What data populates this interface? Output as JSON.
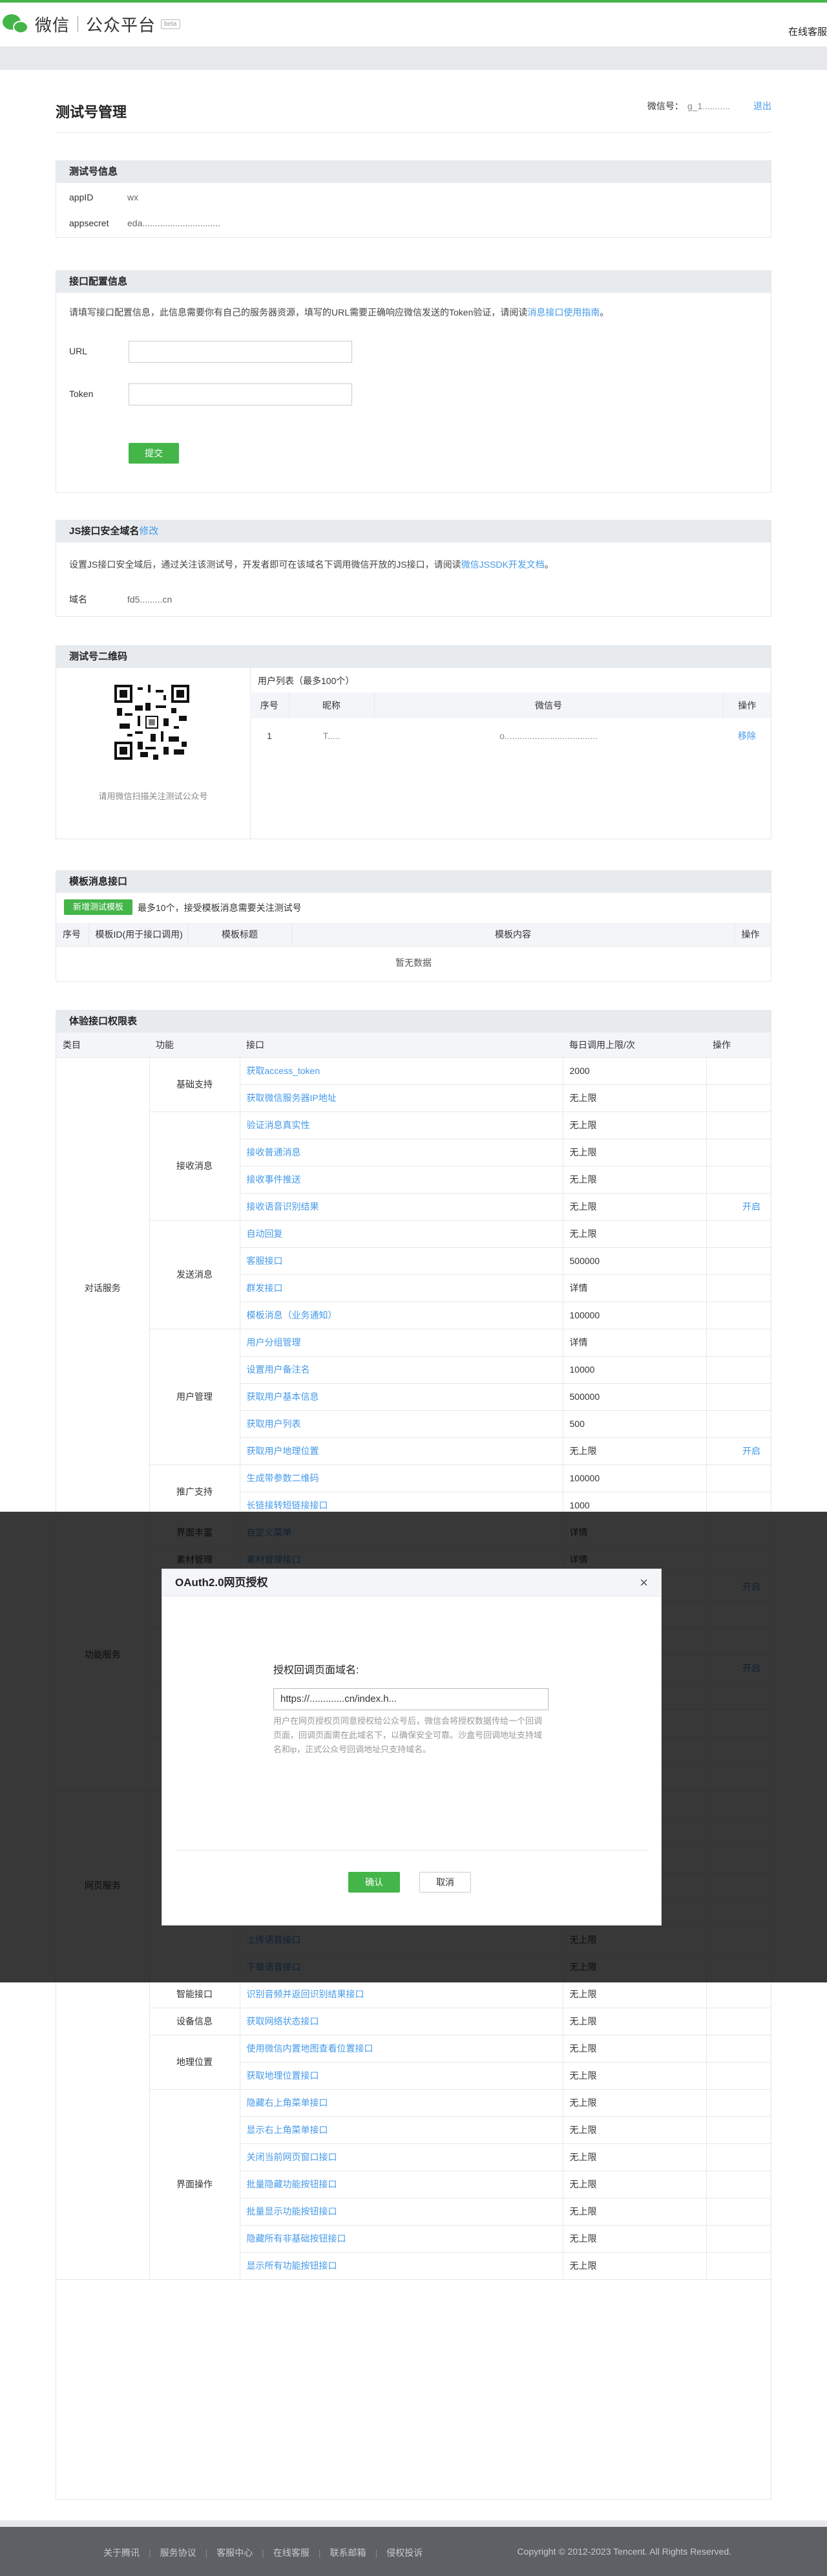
{
  "header": {
    "logo_text": "微信",
    "product": "公众平台",
    "badge": "beta",
    "right_text": "在线客服"
  },
  "page": {
    "title": "测试号管理",
    "account_label": "微信号：",
    "account_value": "g_1...........",
    "logout": "退出"
  },
  "test_info": {
    "title": "测试号信息",
    "appid_label": "appID",
    "appid_value": "wx",
    "secret_label": "appsecret",
    "secret_value": "eda..............................."
  },
  "config": {
    "title": "接口配置信息",
    "desc_prefix": "请填写接口配置信息，此信息需要你有自己的服务器资源，填写的URL需要正确响应微信发送的Token验证，请阅读",
    "desc_link": "消息接口使用指南",
    "desc_suffix": "。",
    "url_label": "URL",
    "token_label": "Token",
    "submit": "提交"
  },
  "js": {
    "title": "JS接口安全域名",
    "modify": "修改",
    "desc_prefix": "设置JS接口安全域后，通过关注该测试号，开发者即可在该域名下调用微信开放的JS接口，请阅读",
    "desc_link": "微信JSSDK开发文档",
    "desc_suffix": "。",
    "domain_label": "域名",
    "domain_value": "fd5.........cn"
  },
  "qrcode": {
    "title": "测试号二维码",
    "caption": "请用微信扫描关注测试公众号",
    "list_title": "用户列表（最多100个）",
    "headers": [
      "序号",
      "昵称",
      "微信号",
      "操作"
    ],
    "rows": [
      {
        "no": "1",
        "nick": "T.....",
        "wxid": "o.....................................",
        "op": "移除"
      }
    ]
  },
  "template": {
    "title": "模板消息接口",
    "add_btn": "新增测试模板",
    "note": "最多10个，接受模板消息需要关注测试号",
    "headers": [
      "序号",
      "模板ID(用于接口调用)",
      "模板标题",
      "模板内容",
      "操作"
    ],
    "empty": "暂无数据"
  },
  "perm": {
    "title": "体验接口权限表",
    "headers": [
      "类目",
      "功能",
      "接口",
      "每日调用上限/次",
      "操作"
    ],
    "rows": [
      {
        "cat": "对话服务",
        "cat_span": 17,
        "grp": "基础支持",
        "grp_span": 2,
        "api": "获取access_token",
        "limit": "2000",
        "op": ""
      },
      {
        "api": "获取微信服务器IP地址",
        "limit": "无上限",
        "op": ""
      },
      {
        "grp": "接收消息",
        "grp_span": 4,
        "api": "验证消息真实性",
        "limit": "无上限",
        "op": ""
      },
      {
        "api": "接收普通消息",
        "limit": "无上限",
        "op": ""
      },
      {
        "api": "接收事件推送",
        "limit": "无上限",
        "op": ""
      },
      {
        "api": "接收语音识别结果",
        "limit": "无上限",
        "op": "开启"
      },
      {
        "grp": "发送消息",
        "grp_span": 4,
        "api": "自动回复",
        "limit": "无上限",
        "op": ""
      },
      {
        "api": "客服接口",
        "limit": "500000",
        "op": ""
      },
      {
        "api": "群发接口",
        "limit": "详情",
        "op": ""
      },
      {
        "api": "模板消息（业务通知）",
        "limit": "100000",
        "op": ""
      },
      {
        "grp": "用户管理",
        "grp_span": 5,
        "api": "用户分组管理",
        "limit": "详情",
        "op": ""
      },
      {
        "api": "设置用户备注名",
        "limit": "10000",
        "op": ""
      },
      {
        "api": "获取用户基本信息",
        "limit": "500000",
        "op": ""
      },
      {
        "api": "获取用户列表",
        "limit": "500",
        "op": ""
      },
      {
        "api": "获取用户地理位置",
        "limit": "无上限",
        "op": "开启"
      },
      {
        "grp": "推广支持",
        "grp_span": 2,
        "api": "生成带参数二维码",
        "limit": "100000",
        "op": ""
      },
      {
        "api": "长链接转短链接接口",
        "limit": "1000",
        "op": ""
      },
      {
        "cat": "功能服务",
        "cat_span": 10,
        "grp": "界面丰富",
        "grp_span": 1,
        "api": "自定义菜单",
        "limit": "详情",
        "op": ""
      },
      {
        "grp": "素材管理",
        "grp_span": 1,
        "api": "素材管理接口",
        "limit": "详情",
        "op": ""
      },
      {
        "grp": "",
        "grp_span": 2,
        "api": "",
        "limit": "",
        "op": "开启"
      },
      {
        "api": "",
        "limit": "",
        "op": ""
      },
      {
        "grp": "",
        "grp_span": 2,
        "api": "",
        "limit": "",
        "op": ""
      },
      {
        "api": "",
        "limit": "",
        "op": "开启"
      },
      {
        "grp": "",
        "grp_span": 2,
        "api": "",
        "limit": "",
        "op": ""
      },
      {
        "api": "",
        "limit": "",
        "op": ""
      },
      {
        "grp": "",
        "grp_span": 2,
        "api": "上传图片接口",
        "limit": "无上限",
        "op": ""
      },
      {
        "api": "下载图片接口",
        "limit": "无上限",
        "op": ""
      },
      {
        "cat": "网页服务",
        "cat_span": 7,
        "grp": "音频接口",
        "grp_span": 7,
        "api": "开始录音接口",
        "limit": "无上限",
        "op": ""
      },
      {
        "api": "停止录音接口",
        "limit": "无上限",
        "op": ""
      },
      {
        "api": "播放语音接口",
        "limit": "无上限",
        "op": ""
      },
      {
        "api": "暂停播放接口",
        "limit": "无上限",
        "op": ""
      },
      {
        "api": "停止播放接口",
        "limit": "无上限",
        "op": ""
      },
      {
        "api": "上传语音接口",
        "limit": "无上限",
        "op": ""
      },
      {
        "api": "下载语音接口",
        "limit": "无上限",
        "op": ""
      },
      {
        "cat": "",
        "cat_span": 11,
        "grp": "智能接口",
        "grp_span": 1,
        "api": "识别音频并返回识别结果接口",
        "limit": "无上限",
        "op": ""
      },
      {
        "grp": "设备信息",
        "grp_span": 1,
        "api": "获取网络状态接口",
        "limit": "无上限",
        "op": ""
      },
      {
        "grp": "地理位置",
        "grp_span": 2,
        "api": "使用微信内置地图查看位置接口",
        "limit": "无上限",
        "op": ""
      },
      {
        "api": "获取地理位置接口",
        "limit": "无上限",
        "op": ""
      },
      {
        "grp": "界面操作",
        "grp_span": 7,
        "api": "隐藏右上角菜单接口",
        "limit": "无上限",
        "op": ""
      },
      {
        "api": "显示右上角菜单接口",
        "limit": "无上限",
        "op": ""
      },
      {
        "api": "关闭当前网页窗口接口",
        "limit": "无上限",
        "op": ""
      },
      {
        "api": "批量隐藏功能按钮接口",
        "limit": "无上限",
        "op": ""
      },
      {
        "api": "批量显示功能按钮接口",
        "limit": "无上限",
        "op": ""
      },
      {
        "api": "隐藏所有非基础按钮接口",
        "limit": "无上限",
        "op": ""
      },
      {
        "api": "显示所有功能按钮接口",
        "limit": "无上限",
        "op": ""
      }
    ]
  },
  "dialog": {
    "title": "OAuth2.0网页授权",
    "label": "授权回调页面域名:",
    "value": "https://.............cn/index.h...",
    "tip": "用户在网页授权页同意授权给公众号后，微信会将授权数据传给一个回调页面，回调页面需在此域名下，以确保安全可靠。沙盒号回调地址支持域名和ip，正式公众号回调地址只支持域名。",
    "ok": "确认",
    "cancel": "取消"
  },
  "footer": {
    "links": [
      "关于腾讯",
      "服务协议",
      "客服中心",
      "在线客服",
      "联系邮箱",
      "侵权投诉"
    ],
    "copyright": "Copyright © 2012-2023 Tencent. All Rights Reserved."
  }
}
